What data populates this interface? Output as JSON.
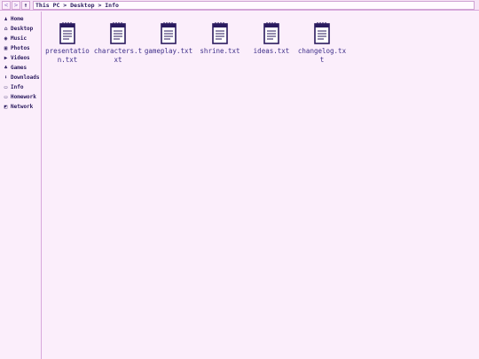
{
  "toolbar": {
    "back_glyph": "<",
    "forward_glyph": ">",
    "up_glyph": "↑",
    "address": "This PC > Desktop > Info"
  },
  "sidebar": {
    "items": [
      {
        "label": "Home",
        "icon": "person-icon",
        "glyph": "♟"
      },
      {
        "label": "Desktop",
        "icon": "desktop-icon",
        "glyph": "⌂"
      },
      {
        "label": "Music",
        "icon": "music-icon",
        "glyph": "◉"
      },
      {
        "label": "Photos",
        "icon": "photo-icon",
        "glyph": "▣"
      },
      {
        "label": "Videos",
        "icon": "video-icon",
        "glyph": "▶"
      },
      {
        "label": "Games",
        "icon": "game-icon",
        "glyph": "♣"
      },
      {
        "label": "Downloads",
        "icon": "download-icon",
        "glyph": "⬇"
      },
      {
        "label": "Info",
        "icon": "folder-icon",
        "glyph": "▭"
      },
      {
        "label": "Homework",
        "icon": "folder-icon",
        "glyph": "▭"
      },
      {
        "label": "Network",
        "icon": "network-icon",
        "glyph": "◩"
      }
    ]
  },
  "files": [
    {
      "name": "presentation.txt",
      "icon": "notepad-icon"
    },
    {
      "name": "characters.txt",
      "icon": "notepad-icon"
    },
    {
      "name": "gameplay.txt",
      "icon": "notepad-icon"
    },
    {
      "name": "shrine.txt",
      "icon": "notepad-icon"
    },
    {
      "name": "ideas.txt",
      "icon": "notepad-icon"
    },
    {
      "name": "changelog.txt",
      "icon": "notepad-icon"
    }
  ],
  "colors": {
    "background": "#fbeefb",
    "border": "#d8a8dc",
    "text": "#2a1a5e",
    "filename": "#3f2f8a"
  }
}
